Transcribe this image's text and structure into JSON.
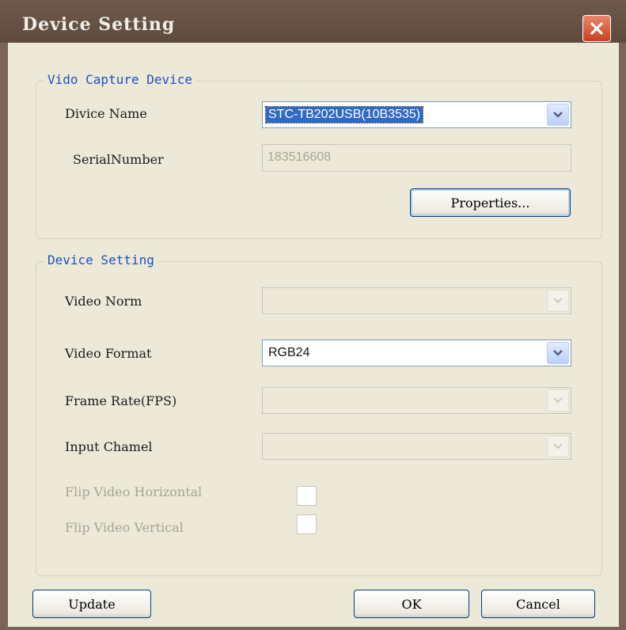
{
  "window": {
    "title": "Device Setting"
  },
  "capture_group": {
    "legend": "Vido Capture Device",
    "device_name_label": "Divice Name",
    "device_name_value": "STC-TB202USB(10B3535)",
    "serial_label": "SerialNumber",
    "serial_value": "183516608",
    "properties_button": "Properties..."
  },
  "setting_group": {
    "legend": "Device Setting",
    "video_norm_label": "Video Norm",
    "video_norm_value": "",
    "video_format_label": "Video Format",
    "video_format_value": "RGB24",
    "frame_rate_label": "Frame Rate(FPS)",
    "frame_rate_value": "",
    "input_channel_label": "Input Chamel",
    "input_channel_value": "",
    "flip_horizontal_label": "Flip Video Horizontal",
    "flip_vertical_label": "Flip Video Vertical"
  },
  "footer": {
    "update_button": "Update",
    "ok_button": "OK",
    "cancel_button": "Cancel"
  },
  "colors": {
    "legend": "#1c4fc4",
    "selection": "#316ac5",
    "close_button": "#c8411f"
  },
  "icons": {
    "close": "close-icon",
    "dropdown": "chevron-down-icon"
  }
}
